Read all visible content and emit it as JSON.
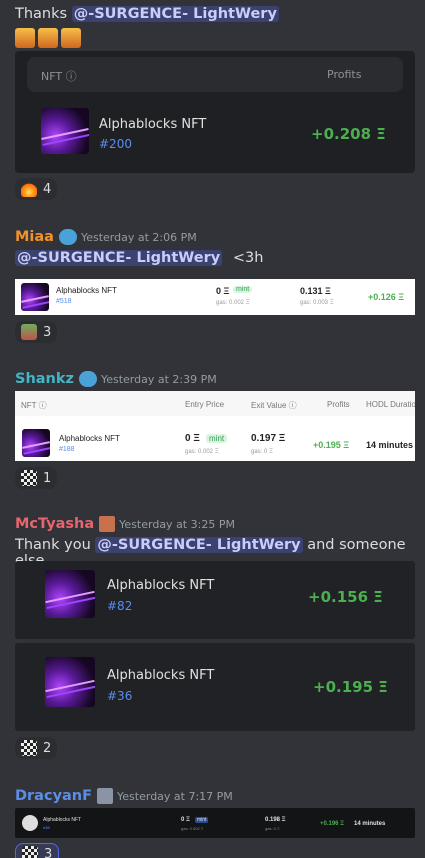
{
  "msg1": {
    "prefix": "Thanks",
    "mention": "@-SURGENCE- LightWery",
    "card": {
      "col_nft": "NFT",
      "col_profits": "Profits",
      "name": "Alphablocks NFT",
      "id": "#200",
      "profit": "+0.208 Ξ"
    },
    "reaction": {
      "emoji": "fire-emoji",
      "count": "4"
    }
  },
  "msg2": {
    "user": "Miaa",
    "user_color": "#f0932b",
    "time": "Yesterday at 2:06 PM",
    "mention": "@-SURGENCE- LightWery",
    "suffix": "<3h",
    "card": {
      "name": "Alphablocks NFT",
      "id": "#518",
      "entry": "0 Ξ",
      "mint": "mint",
      "entry_gas": "gas: 0.002 Ξ",
      "exit": "0.131 Ξ",
      "exit_gas": "gas: 0.003 Ξ",
      "profit": "+0.126 Ξ"
    },
    "reaction": {
      "emoji": "pepe-emoji",
      "count": "3"
    }
  },
  "msg3": {
    "user": "Shankz",
    "user_color": "#45b5c4",
    "time": "Yesterday at 2:39 PM",
    "card": {
      "cols": [
        "NFT",
        "Entry Price",
        "Exit Value",
        "Profits",
        "HODL Duratio"
      ],
      "name": "Alphablocks NFT",
      "id": "#188",
      "entry": "0 Ξ",
      "mint": "mint",
      "entry_gas": "gas: 0.002 Ξ",
      "exit": "0.197 Ξ",
      "exit_gas": "gas: 0 Ξ",
      "profit": "+0.195 Ξ",
      "duration": "14 minutes"
    },
    "reaction": {
      "emoji": "qr-emoji",
      "count": "1"
    }
  },
  "msg4": {
    "user": "McTyasha",
    "user_color": "#e8646e",
    "time": "Yesterday at 3:25 PM",
    "prefix": "Thank you",
    "mention": "@-SURGENCE- LightWery",
    "suffix": "and someone else",
    "card1": {
      "name": "Alphablocks NFT",
      "id": "#82",
      "profit": "+0.156 Ξ"
    },
    "card2": {
      "name": "Alphablocks NFT",
      "id": "#36",
      "profit": "+0.195 Ξ"
    },
    "reaction": {
      "emoji": "qr-emoji",
      "count": "2"
    }
  },
  "msg5": {
    "user": "DracyanF",
    "user_color": "#5b8ee6",
    "time": "Yesterday at 7:17 PM",
    "card": {
      "name": "Alphablocks NFT",
      "id": "#36",
      "entry": "0 Ξ",
      "mint": "mint",
      "entry_gas": "gas: 0.002 Ξ",
      "exit": "0.198 Ξ",
      "exit_gas": "gas: 0 Ξ",
      "profit": "+0.196 Ξ",
      "duration": "14 minutes"
    },
    "reaction": {
      "emoji": "qr-emoji",
      "count": "3"
    }
  }
}
